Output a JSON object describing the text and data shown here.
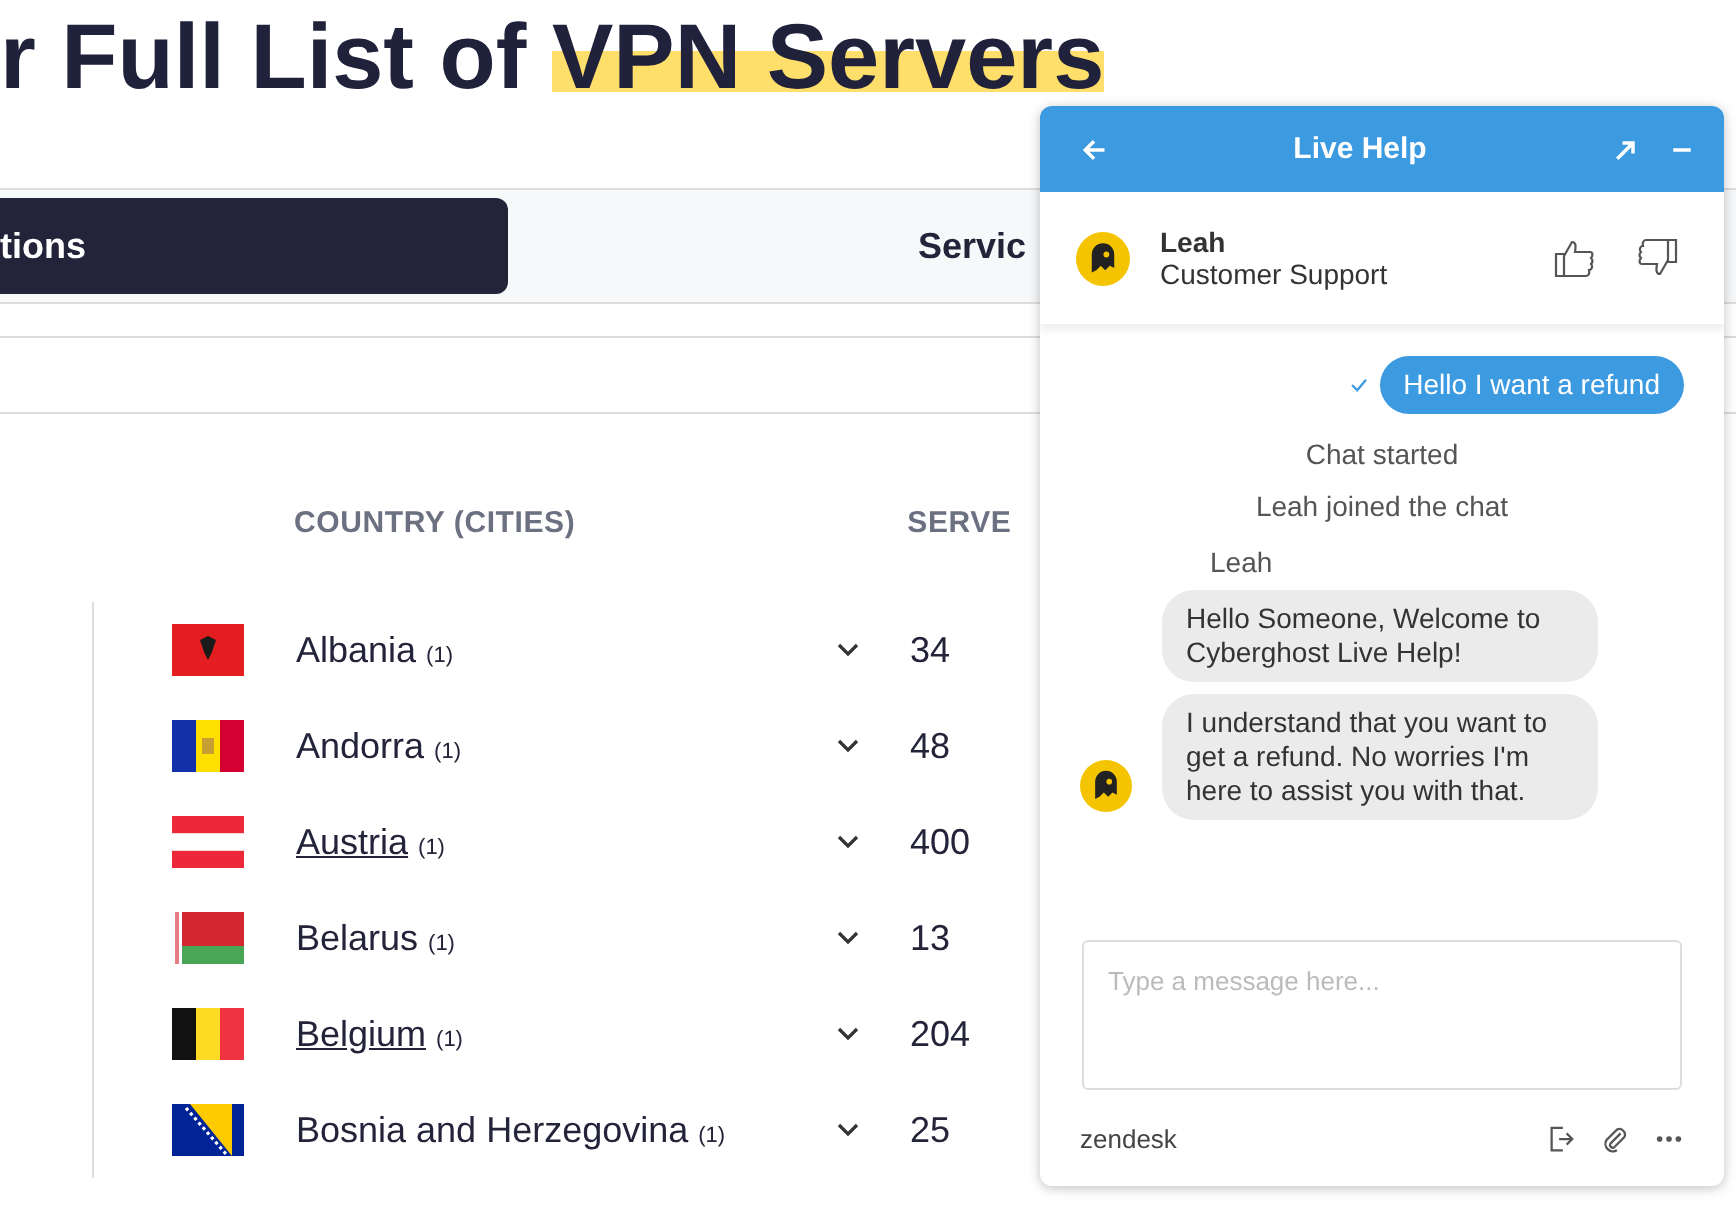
{
  "title": {
    "text": "r Full List of ",
    "highlight": "VPN Servers"
  },
  "tabs": [
    {
      "label": "tions",
      "selected": true
    },
    {
      "label": "Servic",
      "selected": false
    }
  ],
  "table": {
    "columns": [
      "COUNTRY (CITIES)",
      "SERVE"
    ],
    "rows": [
      {
        "country": "Albania",
        "cities": "(1)",
        "servers": "34",
        "linked": false,
        "expanded": false
      },
      {
        "country": "Andorra",
        "cities": "(1)",
        "servers": "48",
        "linked": false,
        "expanded": false
      },
      {
        "country": "Austria",
        "cities": "(1)",
        "servers": "400",
        "linked": true,
        "expanded": false
      },
      {
        "country": "Belarus",
        "cities": "(1)",
        "servers": "13",
        "linked": false,
        "expanded": false
      },
      {
        "country": "Belgium",
        "cities": "(1)",
        "servers": "204",
        "linked": true,
        "expanded": false
      },
      {
        "country": "Bosnia and Herzegovina",
        "cities": "(1)",
        "servers": "25",
        "linked": false,
        "expanded": false
      }
    ]
  },
  "chat": {
    "title": "Live Help",
    "agent": {
      "name": "Leah",
      "role": "Customer Support"
    },
    "messages": [
      {
        "kind": "sent",
        "text": "Hello I want a refund",
        "delivered": true
      },
      {
        "kind": "event",
        "text": "Chat started"
      },
      {
        "kind": "event",
        "text": "Leah joined the chat"
      },
      {
        "kind": "sender",
        "text": "Leah"
      },
      {
        "kind": "received",
        "text": "Hello Someone, Welcome to Cyberghost Live Help!",
        "avatar": false
      },
      {
        "kind": "received",
        "text": "I understand that you want to get a refund. No worries I'm here to assist you with that.",
        "avatar": true
      }
    ],
    "input": {
      "placeholder": "Type a message here..."
    },
    "footer": {
      "brand": "zendesk"
    }
  }
}
